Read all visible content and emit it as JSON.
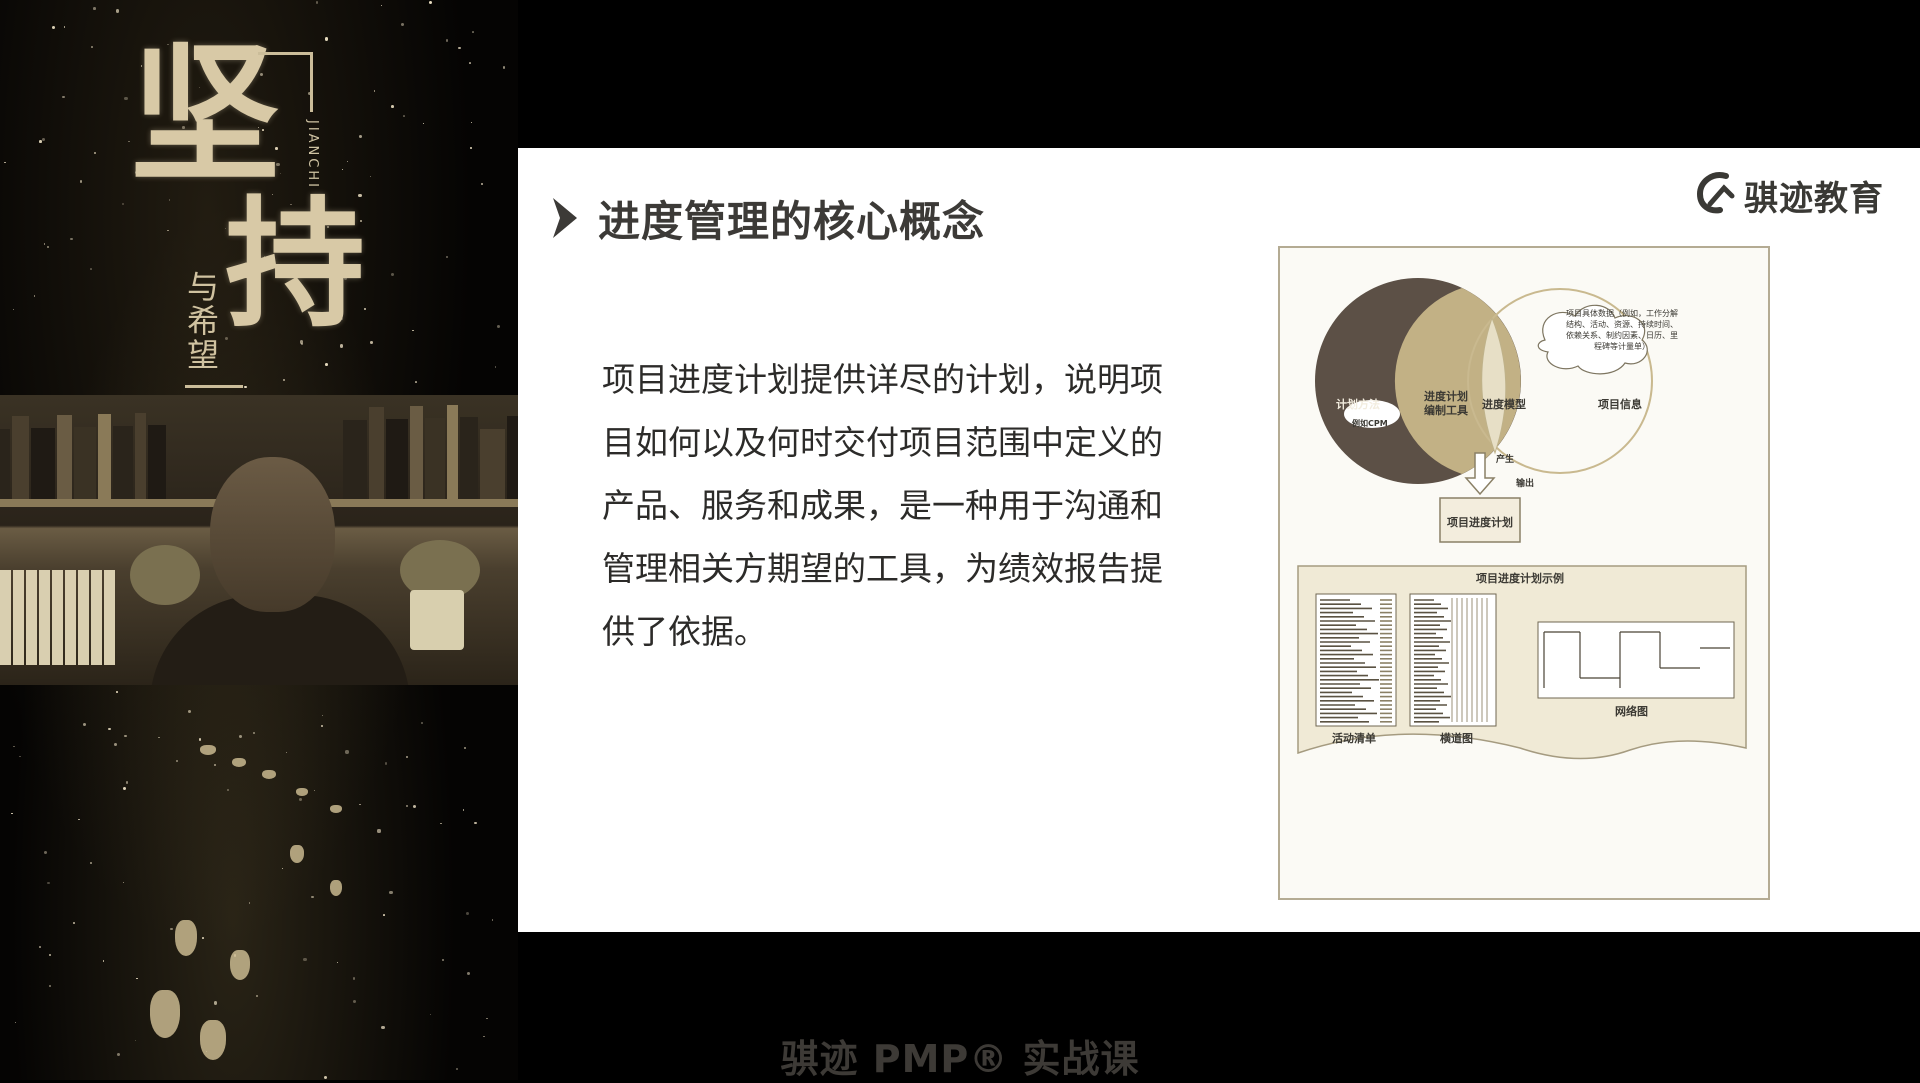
{
  "poster": {
    "big_char_1": "坚",
    "big_char_2": "持",
    "small_text": "与希望",
    "latin_text": "JIANCHI"
  },
  "slide": {
    "title": "进度管理的核心概念",
    "brand_name": "骐迹教育",
    "body": "项目进度计划提供详尽的计划，说明项目如何以及何时交付项目范围中定义的产品、服务和成果，是一种用于沟通和管理相关方期望的工具，为绩效报告提供了依据。"
  },
  "diagram": {
    "left_circle_label": "计划方法",
    "cloud_small_label": "例如CPM",
    "mid_label_line1": "进度计划",
    "mid_label_line2": "编制工具",
    "lens_label": "进度模型",
    "right_circle_label": "项目信息",
    "cloud_text": "项目具体数据（例如，工作分解结构、活动、资源、持续时间、依赖关系、制约因素、日历、里程碑等计量单）",
    "produce_label": "产生",
    "output_label": "输出",
    "schedule_box_label": "项目进度计划",
    "examples_title": "项目进度计划示例",
    "activity_list_label": "活动清单",
    "bar_chart_label": "横道图",
    "network_label": "网络图"
  },
  "caption": "骐迹 PMP® 实战课",
  "colors": {
    "slide_bg": "#ffffff",
    "title_text": "#3c3a37",
    "dark_circle": "#5c5046",
    "tan_fill": "#c2b185",
    "gold": "#c9b98f"
  }
}
